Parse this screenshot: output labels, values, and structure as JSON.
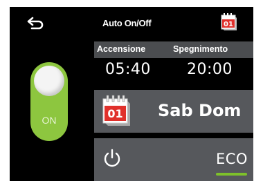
{
  "header": {
    "title": "Auto On/Off",
    "back_icon": "back-arrow-icon",
    "calendar_icon_text": "01"
  },
  "schedule": {
    "on_label": "Accensione",
    "off_label": "Spegnimento",
    "on_time": "05:40",
    "off_time": "20:00"
  },
  "days": {
    "calendar_icon_text": "01",
    "label": "Sab Dom"
  },
  "mode": {
    "power_icon": "power-icon",
    "label": "ECO"
  },
  "toggle": {
    "state_label": "ON"
  },
  "colors": {
    "background": "#000000",
    "panel": "#56585c",
    "panel_header": "#4b4d50",
    "accent_green": "#8dc63f",
    "calendar_red": "#e0302b"
  }
}
